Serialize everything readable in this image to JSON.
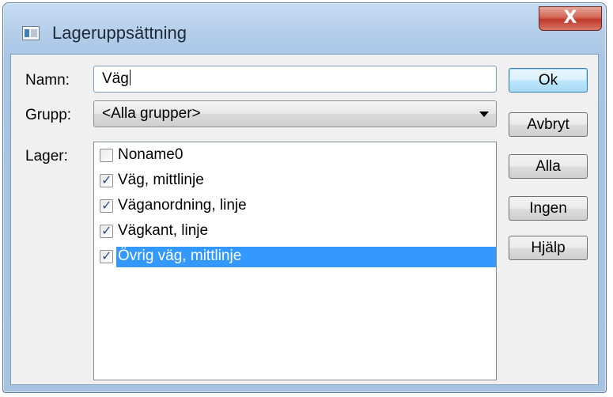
{
  "window": {
    "title": "Lageruppsättning",
    "close_label": "X"
  },
  "form": {
    "name_label": "Namn:",
    "name_value": "Väg",
    "group_label": "Grupp:",
    "group_value": "<Alla grupper>",
    "layers_label": "Lager:"
  },
  "layers": [
    {
      "label": "Noname0",
      "checked": false,
      "selected": false
    },
    {
      "label": "Väg, mittlinje",
      "checked": true,
      "selected": false
    },
    {
      "label": "Väganordning, linje",
      "checked": true,
      "selected": false
    },
    {
      "label": "Vägkant, linje",
      "checked": true,
      "selected": false
    },
    {
      "label": "Övrig väg, mittlinje",
      "checked": true,
      "selected": true
    }
  ],
  "buttons": {
    "ok": "Ok",
    "cancel": "Avbryt",
    "all": "Alla",
    "none": "Ingen",
    "help": "Hjälp"
  }
}
